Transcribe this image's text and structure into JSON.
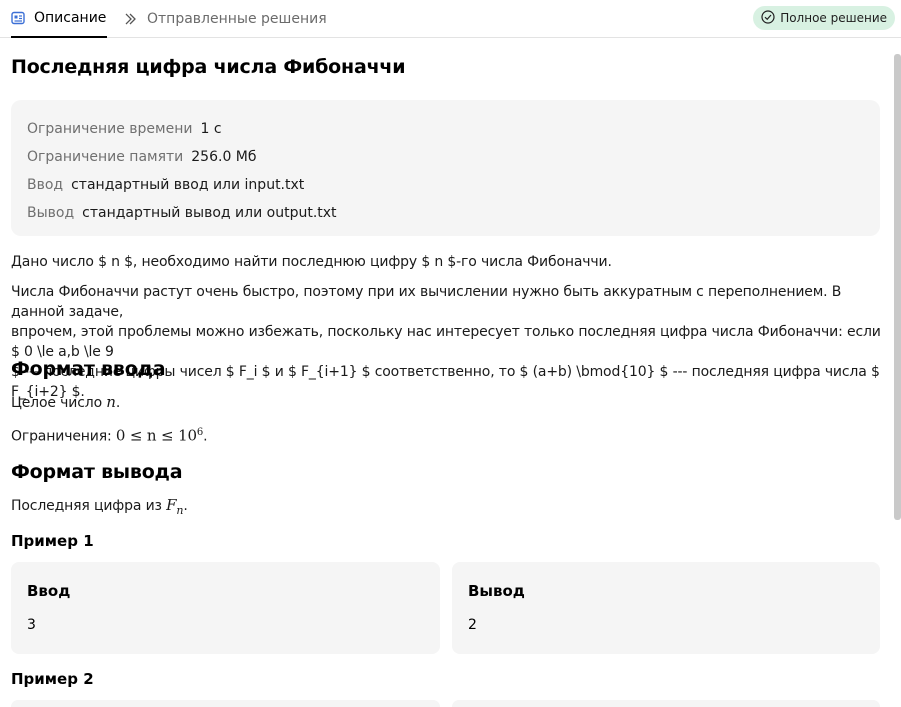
{
  "tabs": {
    "description": "Описание",
    "submissions": "Отправленные решения",
    "status": "Полное решение"
  },
  "problem": {
    "title": "Последняя цифра числа Фибоначчи",
    "limits": [
      {
        "label": "Ограничение времени",
        "value": "1 с"
      },
      {
        "label": "Ограничение памяти",
        "value": "256.0 Мб"
      },
      {
        "label": "Ввод",
        "value": "стандартный ввод или input.txt"
      },
      {
        "label": "Вывод",
        "value": "стандартный вывод или output.txt"
      }
    ],
    "statement_1": "Дано число $ n $, необходимо найти последнюю цифру $ n $-го числа Фибоначчи.",
    "statement_2_line1": "Числа Фибоначчи растут очень быстро, поэтому при их вычислении нужно быть аккуратным с переполнением. В данной задаче,",
    "statement_2_line2": "впрочем, этой проблемы можно избежать, поскольку нас интересует только последняя цифра числа Фибоначчи: если $ 0 \\le a,b \\le 9",
    "statement_2_line3": "$ --- последние цифры чисел $ F_i $ и $ F_{i+1} $ соответственно, то $ (a+b) \\bmod{10} $ --- последняя цифра числа $ F_{i+2} $.",
    "input_format_title": "Формат ввода",
    "input_line1_text": "Целое число ",
    "input_line1_math": "n",
    "input_line2_text": "Ограничения: ",
    "input_line2_math": "0 ≤ n ≤ 10",
    "input_line2_sup": "6",
    "output_format_title": "Формат вывода",
    "output_line_text": "Последняя цифра из ",
    "output_math": "F",
    "output_sub": "n",
    "examples": [
      {
        "title": "Пример 1",
        "input_label": "Ввод",
        "input": "3",
        "output_label": "Вывод",
        "output": "2"
      },
      {
        "title": "Пример 2"
      }
    ]
  }
}
